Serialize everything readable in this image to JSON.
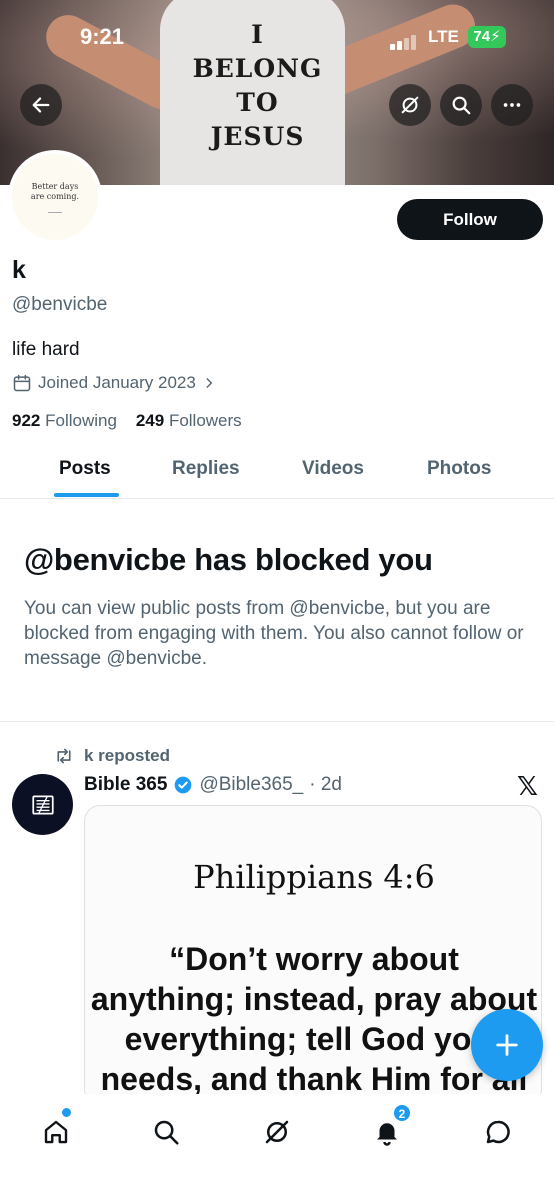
{
  "status_bar": {
    "time": "9:21",
    "network": "LTE",
    "battery": "74"
  },
  "banner": {
    "shirt_text": [
      "I",
      "BELONG",
      "TO",
      "JESUS"
    ]
  },
  "avatar_text": {
    "line1": "Better days",
    "line2": "are coming."
  },
  "profile": {
    "follow_label": "Follow",
    "name": "k",
    "handle": "@benvicbe",
    "bio": "life hard",
    "joined": "Joined January 2023",
    "following_count": "922",
    "following_label": "Following",
    "followers_count": "249",
    "followers_label": "Followers"
  },
  "tabs": [
    {
      "label": "Posts"
    },
    {
      "label": "Replies"
    },
    {
      "label": "Videos"
    },
    {
      "label": "Photos"
    }
  ],
  "blocked": {
    "title": "@benvicbe has blocked you",
    "body": "You can view public posts from @benvicbe, but you are blocked from engaging with them. You also cannot follow or message @benvicbe."
  },
  "post": {
    "repost_label": "k reposted",
    "author_name": "Bible 365",
    "author_handle": "@Bible365_",
    "time": "· 2d",
    "image_ref": "Philippians 4:6",
    "image_quote": [
      "“Don’t worry about",
      "anything; instead, pray about",
      "everything; tell God your",
      "needs, and thank Him for all"
    ]
  },
  "bottom_nav": {
    "notifications_badge": "2"
  },
  "colors": {
    "accent": "#1d9bf0",
    "text": "#0f1419",
    "muted": "#536471"
  }
}
